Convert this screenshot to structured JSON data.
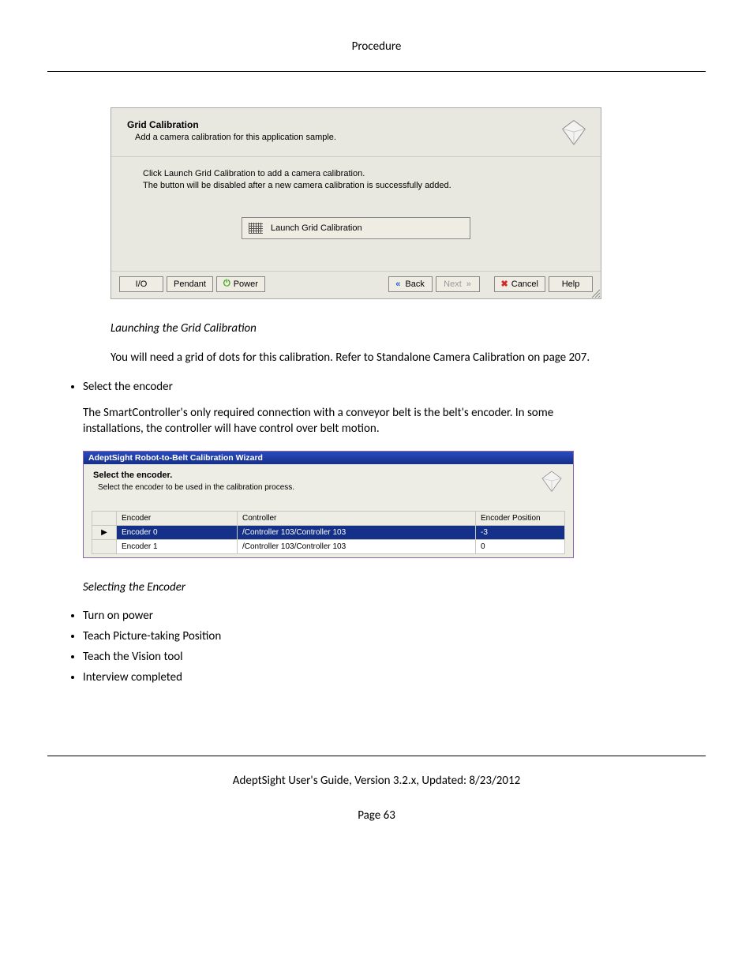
{
  "header": {
    "title": "Procedure"
  },
  "figure1": {
    "title": "Grid Calibration",
    "subtitle": "Add a camera calibration for this application sample.",
    "instruction_line1": "Click Launch Grid Calibration to add a camera calibration.",
    "instruction_line2": "The button will be disabled after a new camera calibration is successfully added.",
    "launch_label": "Launch Grid Calibration",
    "buttons": {
      "io": "I/O",
      "pendant": "Pendant",
      "power": "Power",
      "back": "Back",
      "next": "Next",
      "cancel": "Cancel",
      "help": "Help"
    }
  },
  "caption1": "Launching the Grid Calibration",
  "para1": "You will need a grid of dots for this calibration. Refer to Standalone Camera Calibration on page 207.",
  "bullet_encoder": "Select the encoder",
  "para_encoder": "The SmartController's only required connection with a conveyor belt is the belt's encoder. In some installations, the controller will have control over belt motion.",
  "figure2": {
    "window_title": "AdeptSight Robot-to-Belt Calibration Wizard",
    "head_title": "Select the encoder.",
    "head_sub": "Select the encoder to be used in the calibration process.",
    "columns": {
      "c0": "",
      "c1": "Encoder",
      "c2": "Controller",
      "c3": "Encoder Position"
    },
    "rows": [
      {
        "marker": "▶",
        "encoder": "Encoder 0",
        "controller": "/Controller 103/Controller 103",
        "pos": "-3",
        "selected": true
      },
      {
        "marker": "",
        "encoder": "Encoder 1",
        "controller": "/Controller 103/Controller 103",
        "pos": "0",
        "selected": false
      }
    ]
  },
  "caption2": "Selecting the Encoder",
  "bullets_after": [
    "Turn on power",
    "Teach Picture-taking Position",
    "Teach the Vision tool",
    "Interview completed"
  ],
  "footer": {
    "text": "AdeptSight User's Guide,  Version 3.2.x, Updated: 8/23/2012",
    "page": "Page 63"
  }
}
